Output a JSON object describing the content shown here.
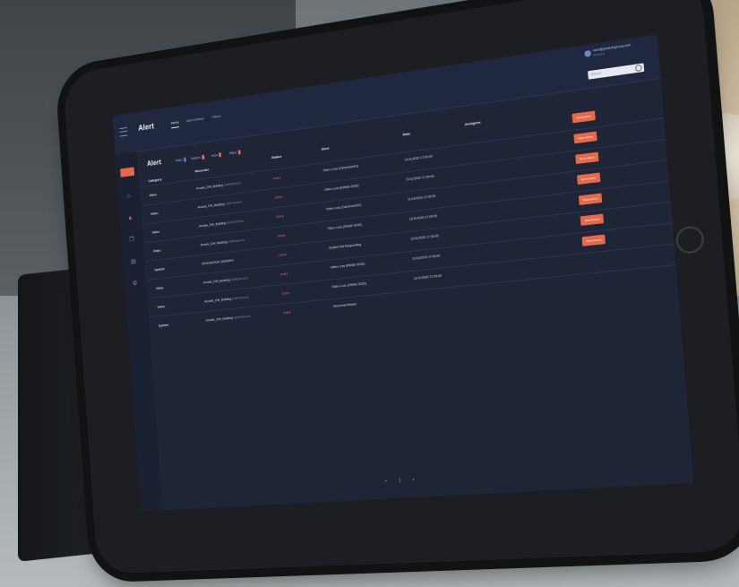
{
  "app": {
    "title": "Alert"
  },
  "nav_tabs": [
    {
      "label": "Alerts",
      "active": true
    },
    {
      "label": "Alert History",
      "active": false
    },
    {
      "label": "Filters",
      "active": false
    }
  ],
  "user": {
    "email": "user@powerbyproxy.com",
    "role": "ID Admin"
  },
  "search": {
    "placeholder": "Search"
  },
  "main": {
    "title": "Alert",
    "filters": [
      {
        "label": "Video",
        "color": "#4f7cd6"
      },
      {
        "label": "System",
        "color": "#e8694a"
      },
      {
        "label": "Area",
        "color": "#e8694a"
      },
      {
        "label": "Fitted",
        "color": "#e8694a"
      }
    ],
    "columns": {
      "category": "Category",
      "recorder": "Recorder",
      "status": "Status",
      "alert": "Alert",
      "date": "Date",
      "assignee": "Assignee"
    },
    "rows": [
      {
        "category": "Video",
        "recorder": "Arcade_DW_Building",
        "recorder_sub": "Hall/Entrance",
        "status": "Active",
        "alert": "Video Loss (Camera/ch01)",
        "date": "11/11/2020 17:00:00"
      },
      {
        "category": "Video",
        "recorder": "Arcade_DW_Building",
        "recorder_sub": "Hall/Entrance",
        "status": "Active",
        "alert": "Video Loss (DW&E-S032)",
        "date": "11/11/2020 17:00:00"
      },
      {
        "category": "Video",
        "recorder": "Arcade_DW_Building",
        "recorder_sub": "Hall/Entrance",
        "status": "Active",
        "alert": "Video Loss (Camera/ch02)",
        "date": "11/11/2020 17:00:00"
      },
      {
        "category": "Video",
        "recorder": "Arcade_DW_Building",
        "recorder_sub": "Hall/Entrance",
        "status": "Active",
        "alert": "Video Loss (DW&E-S032)",
        "date": "11/11/2020 17:00:00"
      },
      {
        "category": "System",
        "recorder": "DENVENGEA_WENDER",
        "recorder_sub": "",
        "status": "Active",
        "alert": "System Not Responding",
        "date": "11/11/2020 17:00:00"
      },
      {
        "category": "Video",
        "recorder": "Arcade_DW_Building",
        "recorder_sub": "Hall/Entrance",
        "status": "Active",
        "alert": "Video Loss (DW&E-S032)",
        "date": "11/11/2020 17:00:00"
      },
      {
        "category": "Video",
        "recorder": "Arcade_DW_Building",
        "recorder_sub": "Hall/Entrance",
        "status": "Active",
        "alert": "Video Loss (DW&E-S032)",
        "date": "11/11/2020 17:00:00"
      },
      {
        "category": "System",
        "recorder": "Arcade_DW_Building",
        "recorder_sub": "Hall/Entrance",
        "status": "Active",
        "alert": "Abnormal Restart",
        "date": ""
      }
    ],
    "row_button_label": "Show Alerts",
    "pager": "• 1 •"
  },
  "colors": {
    "accent": "#e8694a",
    "screen_bg": "#1e2537"
  }
}
